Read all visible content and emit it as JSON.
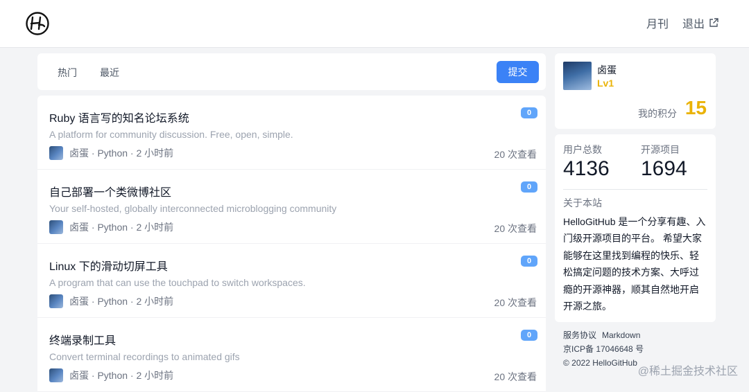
{
  "header": {
    "logo_icon": "hellogithub-logo",
    "nav": {
      "monthly": "月刊",
      "logout": "退出"
    }
  },
  "tabs": {
    "hot": "热门",
    "recent": "最近",
    "submit": "提交"
  },
  "items": [
    {
      "title": "Ruby 语言写的知名论坛系统",
      "desc": "A platform for community discussion. Free, open, simple.",
      "meta": "卤蛋 · Python · 2 小时前",
      "badge": "0",
      "views": "20 次查看"
    },
    {
      "title": "自己部署一个类微博社区",
      "desc": "Your self-hosted, globally interconnected microblogging community",
      "meta": "卤蛋 · Python · 2 小时前",
      "badge": "0",
      "views": "20 次查看"
    },
    {
      "title": "Linux 下的滑动切屏工具",
      "desc": "A program that can use the touchpad to switch workspaces.",
      "meta": "卤蛋 · Python · 2 小时前",
      "badge": "0",
      "views": "20 次查看"
    },
    {
      "title": "终端录制工具",
      "desc": "Convert terminal recordings to animated gifs",
      "meta": "卤蛋 · Python · 2 小时前",
      "badge": "0",
      "views": "20 次查看"
    }
  ],
  "user": {
    "name": "卤蛋",
    "level": "Lv1",
    "points_label": "我的积分",
    "points": "15"
  },
  "stats": {
    "users_label": "用户总数",
    "users": "4136",
    "projects_label": "开源项目",
    "projects": "1694",
    "about_label": "关于本站",
    "about_text": "HelloGitHub 是一个分享有趣、入门级开源项目的平台。 希望大家能够在这里找到编程的快乐、轻松搞定问题的技术方案、大呼过瘾的开源神器，顺其自然地开启开源之旅。"
  },
  "footer": {
    "terms": "服务协议",
    "markdown": "Markdown",
    "icp": "京ICP备 17046648 号",
    "copyright": "© 2022 HelloGitHub"
  },
  "watermark": "@稀土掘金技术社区",
  "colors": {
    "accent": "#3b82f6",
    "badge": "#60a5fa",
    "gold": "#eab308"
  }
}
